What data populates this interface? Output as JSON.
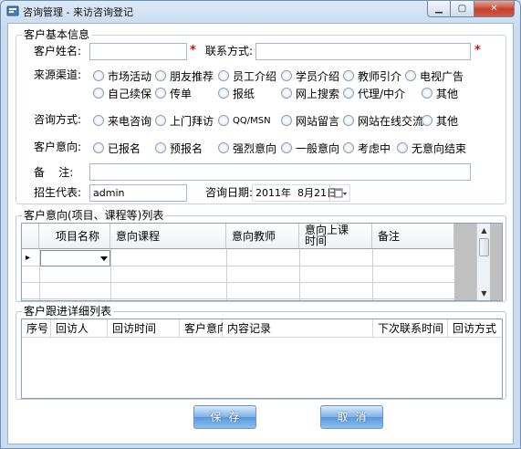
{
  "window": {
    "title": "咨询管理 - 来访咨询登记"
  },
  "basic_info": {
    "legend": "客户基本信息",
    "name_label": "客户姓名:",
    "name_value": "",
    "contact_label": "联系方式:",
    "contact_value": "",
    "required_mark": "*",
    "source_label": "来源渠道:",
    "source_options": [
      "市场活动",
      "朋友推荐",
      "员工介绍",
      "学员介绍",
      "教师引介",
      "电视广告",
      "自己续保",
      "传单",
      "报纸",
      "网上搜索",
      "代理/中介",
      "其他"
    ],
    "method_label": "咨询方式:",
    "method_options": [
      "来电咨询",
      "上门拜访",
      "QQ/MSN",
      "网站留言",
      "网站在线交流",
      "其他"
    ],
    "intent_label": "客户意向:",
    "intent_options": [
      "已报名",
      "预报名",
      "强烈意向",
      "一般意向",
      "考虑中",
      "无意向结束"
    ],
    "remark_label": "备    注:",
    "remark_value": "",
    "rep_label": "招生代表:",
    "rep_value": "admin",
    "date_label": "咨询日期:",
    "date_value": "2011年  8月21日"
  },
  "intent_grid": {
    "legend": "客户意向(项目、课程等)列表",
    "columns": [
      "项目名称",
      "意向课程",
      "意向教师",
      "意向上课\n时间",
      "备注"
    ],
    "row_marker": "▸"
  },
  "followup_list": {
    "legend": "客户跟进详细列表",
    "columns": [
      "序号",
      "回访人",
      "回访时间",
      "客户意向",
      "内容记录",
      "下次联系时间",
      "回访方式"
    ]
  },
  "buttons": {
    "save": "保存",
    "cancel": "取消"
  },
  "icons": {
    "app": "app-icon",
    "calendar": "calendar-icon",
    "dropdown": "chevron-down-icon"
  }
}
